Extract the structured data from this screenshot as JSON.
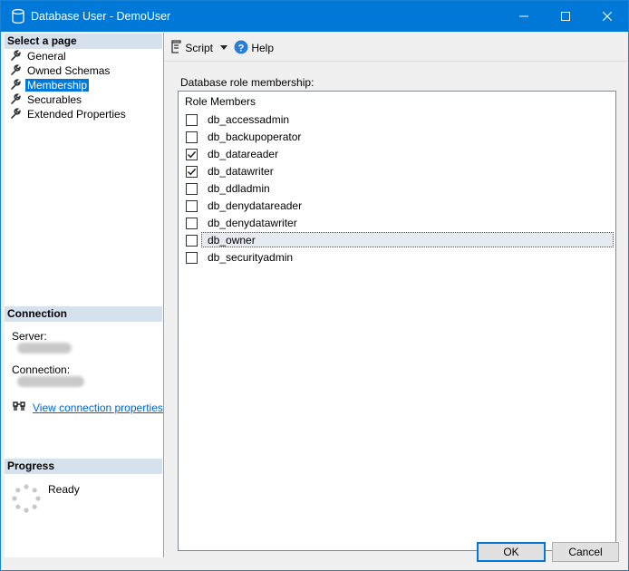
{
  "window": {
    "title": "Database User - DemoUser"
  },
  "left_pane": {
    "select_page_header": "Select a page",
    "pages": [
      {
        "label": "General",
        "selected": false
      },
      {
        "label": "Owned Schemas",
        "selected": false
      },
      {
        "label": "Membership",
        "selected": true
      },
      {
        "label": "Securables",
        "selected": false
      },
      {
        "label": "Extended Properties",
        "selected": false
      }
    ],
    "connection_header": "Connection",
    "server_label": "Server:",
    "connection_label": "Connection:",
    "view_connection_link": "View connection properties",
    "progress_header": "Progress",
    "progress_status": "Ready"
  },
  "toolbar": {
    "script_label": "Script",
    "help_label": "Help"
  },
  "membership": {
    "label": "Database role membership:",
    "column_header": "Role Members",
    "roles": [
      {
        "name": "db_accessadmin",
        "checked": false
      },
      {
        "name": "db_backupoperator",
        "checked": false
      },
      {
        "name": "db_datareader",
        "checked": true
      },
      {
        "name": "db_datawriter",
        "checked": true
      },
      {
        "name": "db_ddladmin",
        "checked": false
      },
      {
        "name": "db_denydatareader",
        "checked": false
      },
      {
        "name": "db_denydatawriter",
        "checked": false
      },
      {
        "name": "db_owner",
        "checked": false,
        "focused": true
      },
      {
        "name": "db_securityadmin",
        "checked": false
      }
    ]
  },
  "buttons": {
    "ok_label": "OK",
    "cancel_label": "Cancel"
  },
  "colors": {
    "titlebar": "#0078d7",
    "selected": "#0078d7",
    "section_header": "#d6e1ee",
    "link": "#0066cc"
  }
}
